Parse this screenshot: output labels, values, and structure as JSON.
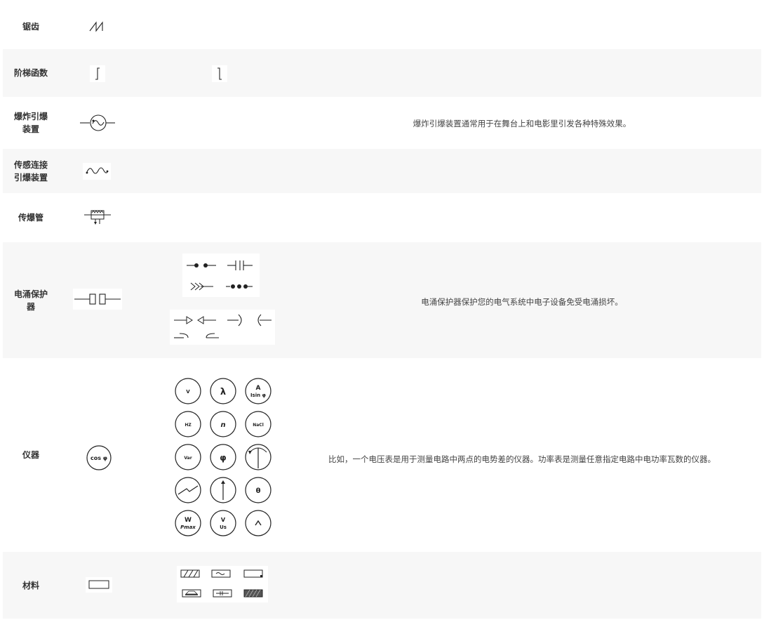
{
  "rows": [
    {
      "label": "锯齿",
      "icon": "sawtooth-icon"
    },
    {
      "label": "阶梯函数",
      "icon": "step-function-icon"
    },
    {
      "label": "爆炸引爆装置",
      "icon": "explosive-detonator-icon",
      "description": "爆炸引爆装置通常用于在舞台上和电影里引发各种特殊效果。"
    },
    {
      "label": "传感连接引爆装置",
      "icon": "sensor-detonator-icon"
    },
    {
      "label": "传爆管",
      "icon": "detonating-tube-icon"
    },
    {
      "label": "电涌保护器",
      "icon": "surge-protector-icon",
      "description": "电涌保护器保护您的电气系统中电子设备免受电涌损坏。"
    },
    {
      "label": "仪器",
      "icon": "instrument-icon",
      "description": "比如，一个电压表是用于测量电路中两点的电势差的仪器。功率表是测量任意指定电路中电功率瓦数的仪器。"
    },
    {
      "label": "材料",
      "icon": "material-icon"
    }
  ],
  "labels_split": {
    "explosive_1": "爆炸引爆",
    "explosive_2": "装置",
    "sensor_1": "传感连接",
    "sensor_2": "引爆装置",
    "surge_1": "电涌保护",
    "surge_2": "器"
  },
  "meter_labels": {
    "v": "V",
    "a": "A",
    "sin_phi": "Isin φ",
    "hz": "HZ",
    "n": "n",
    "nacl": "NaCl",
    "var": "Var",
    "phi": "φ",
    "theta": "θ",
    "w": "W",
    "p_max": "Pmax",
    "u_s": "Us",
    "lambda": "λ",
    "cos_phi": "cos φ"
  }
}
